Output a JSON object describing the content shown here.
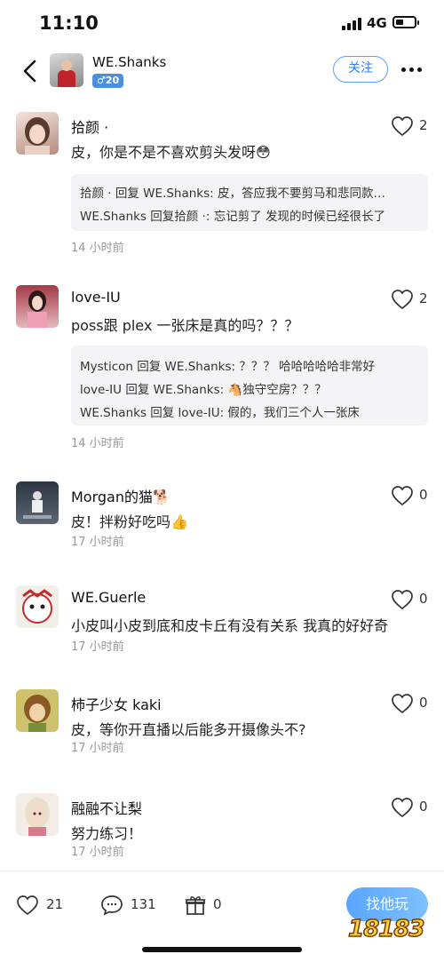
{
  "status_bar": {
    "time": "11:10",
    "network": "4G"
  },
  "header": {
    "username": "WE.Shanks",
    "gender_badge": "♂20",
    "follow_label": "关注"
  },
  "comments": [
    {
      "name": "拾颜 ·",
      "text": "皮，你是不是不喜欢剪头发呀😳",
      "likes": "2",
      "time": "14 小时前",
      "replies": [
        "拾颜 · 回复 WE.Shanks: 皮，答应我不要剪马和悲同款…",
        "WE.Shanks 回复拾颜 ·: 忘记剪了 发现的时候已经很长了"
      ]
    },
    {
      "name": "love-IU",
      "text": "poss跟 plex 一张床是真的吗？？？",
      "likes": "2",
      "time": "14 小时前",
      "replies": [
        "Mysticon 回复 WE.Shanks: ？？？ 哈哈哈哈哈非常好",
        "love-IU 回复 WE.Shanks: 🐴独守空房？？？",
        "WE.Shanks 回复 love-IU: 假的，我们三个人一张床"
      ]
    },
    {
      "name": "Morgan的猫🐕",
      "text": "皮！拌粉好吃吗👍",
      "likes": "0",
      "time": "17 小时前",
      "replies": []
    },
    {
      "name": "WE.Guerle",
      "text": "小皮叫小皮到底和皮卡丘有没有关系 我真的好好奇",
      "likes": "0",
      "time": "17 小时前",
      "replies": []
    },
    {
      "name": "柿子少女 kaki",
      "text": "皮，等你开直播以后能多开摄像头不?",
      "likes": "0",
      "time": "17 小时前",
      "replies": []
    },
    {
      "name": "融融不让梨",
      "text": "努力练习！",
      "likes": "0",
      "time": "17 小时前",
      "replies": []
    }
  ],
  "bottom_bar": {
    "likes": "21",
    "comments": "131",
    "gifts": "0",
    "play_label": "找他玩"
  },
  "watermark": "18183",
  "icons": {
    "back": "chevron-left-icon",
    "more": "more-horizontal-icon",
    "like": "heart-outline-icon",
    "comment": "comment-bubble-icon",
    "gift": "gift-icon"
  },
  "colors": {
    "accent": "#4a90e2",
    "follow": "#2f7ff2",
    "meta": "#999999"
  }
}
